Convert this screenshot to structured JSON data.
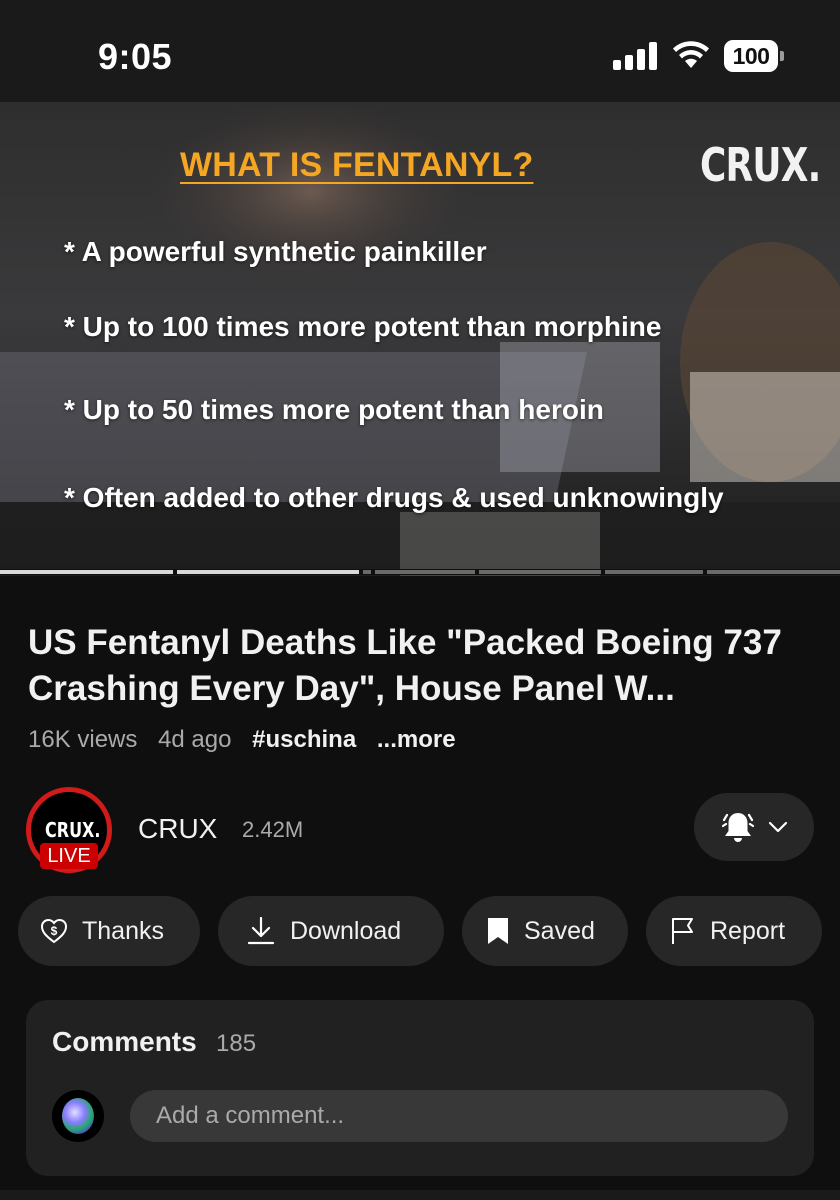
{
  "status_bar": {
    "time": "9:05",
    "battery": "100",
    "icons": [
      "signal-icon",
      "wifi-icon",
      "battery-icon"
    ]
  },
  "video": {
    "overlay_title": "WHAT IS FENTANYL?",
    "overlay_logo": "CRUX.",
    "bullets": [
      "* A powerful synthetic painkiller",
      "* Up to 100 times more potent than morphine",
      "* Up to 50 times more potent than heroin",
      "* Often added to other drugs & used unknowingly"
    ],
    "colors": {
      "title": "#f5a623",
      "progress_played": "#d9d9d9",
      "progress_remaining": "#6a6a6a"
    }
  },
  "info": {
    "title": "US Fentanyl Deaths Like \"Packed Boeing 737 Crashing Every Day\", House Panel W...",
    "views": "16K views",
    "age": "4d ago",
    "hashtag": "#uschina",
    "more": "...more"
  },
  "channel": {
    "avatar_text": "CRUX.",
    "live_label": "LIVE",
    "name": "CRUX",
    "subscribers": "2.42M",
    "notification_icon": "bell-icon",
    "colors": {
      "live": "#cc0000",
      "ring": "#d11a1a"
    }
  },
  "actions": {
    "thanks": "Thanks",
    "download": "Download",
    "saved": "Saved",
    "report": "Report"
  },
  "comments": {
    "header": "Comments",
    "count": "185",
    "placeholder": "Add a comment..."
  }
}
